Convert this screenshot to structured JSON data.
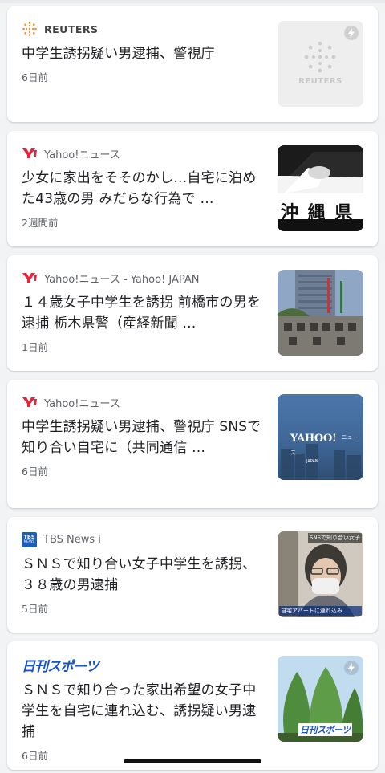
{
  "articles": [
    {
      "source": "REUTERS",
      "headline": "中学生誘拐疑い男逮捕、警視庁",
      "time": "6日前",
      "thumb_text": "REUTERS",
      "logo": "reuters-logo"
    },
    {
      "source": "Yahoo!ニュース",
      "headline": "少女に家出をそそのかし…自宅に泊めた43歳の男 みだらな行為で …",
      "time": "2週間前",
      "thumb_text": "沖 縄 県",
      "logo": "yahoo-logo"
    },
    {
      "source": "Yahoo!ニュース - Yahoo! JAPAN",
      "headline": "１４歳女子中学生を誘拐 前橋市の男を逮捕 栃木県警（産経新聞 …",
      "time": "1日前",
      "thumb_text": "",
      "logo": "yahoo-logo"
    },
    {
      "source": "Yahoo!ニュース",
      "headline": "中学生誘拐疑い男逮捕、警視庁 SNSで知り合い自宅に（共同通信 …",
      "time": "6日前",
      "thumb_text": "YAHOO!",
      "thumb_sub": "JAPAN",
      "thumb_sub2": "ニュース",
      "logo": "yahoo-logo"
    },
    {
      "source": "TBS News i",
      "headline": "ＳＮＳで知り合い女子中学生を誘拐、３８歳の男逮捕",
      "time": "5日前",
      "thumb_text": "SNSで知り合い女子",
      "thumb_sub": "自宅アパートに連れ込み",
      "logo_text_top": "TBS",
      "logo_text_bottom": "NEWS",
      "logo": "tbs-logo"
    },
    {
      "source": "日刊スポーツ",
      "headline": "ＳＮＳで知り合った家出希望の女子中学生を自宅に連れ込む、誘拐疑い男逮捕",
      "time": "6日前",
      "thumb_text": "日刊スポーツ",
      "logo": "nikkan-logo"
    }
  ],
  "colors": {
    "yahoo_red": "#e6253a",
    "reuters_orange": "#f28c28",
    "tbs_blue": "#1d5fb6",
    "nikkan_blue": "#1554c5"
  }
}
